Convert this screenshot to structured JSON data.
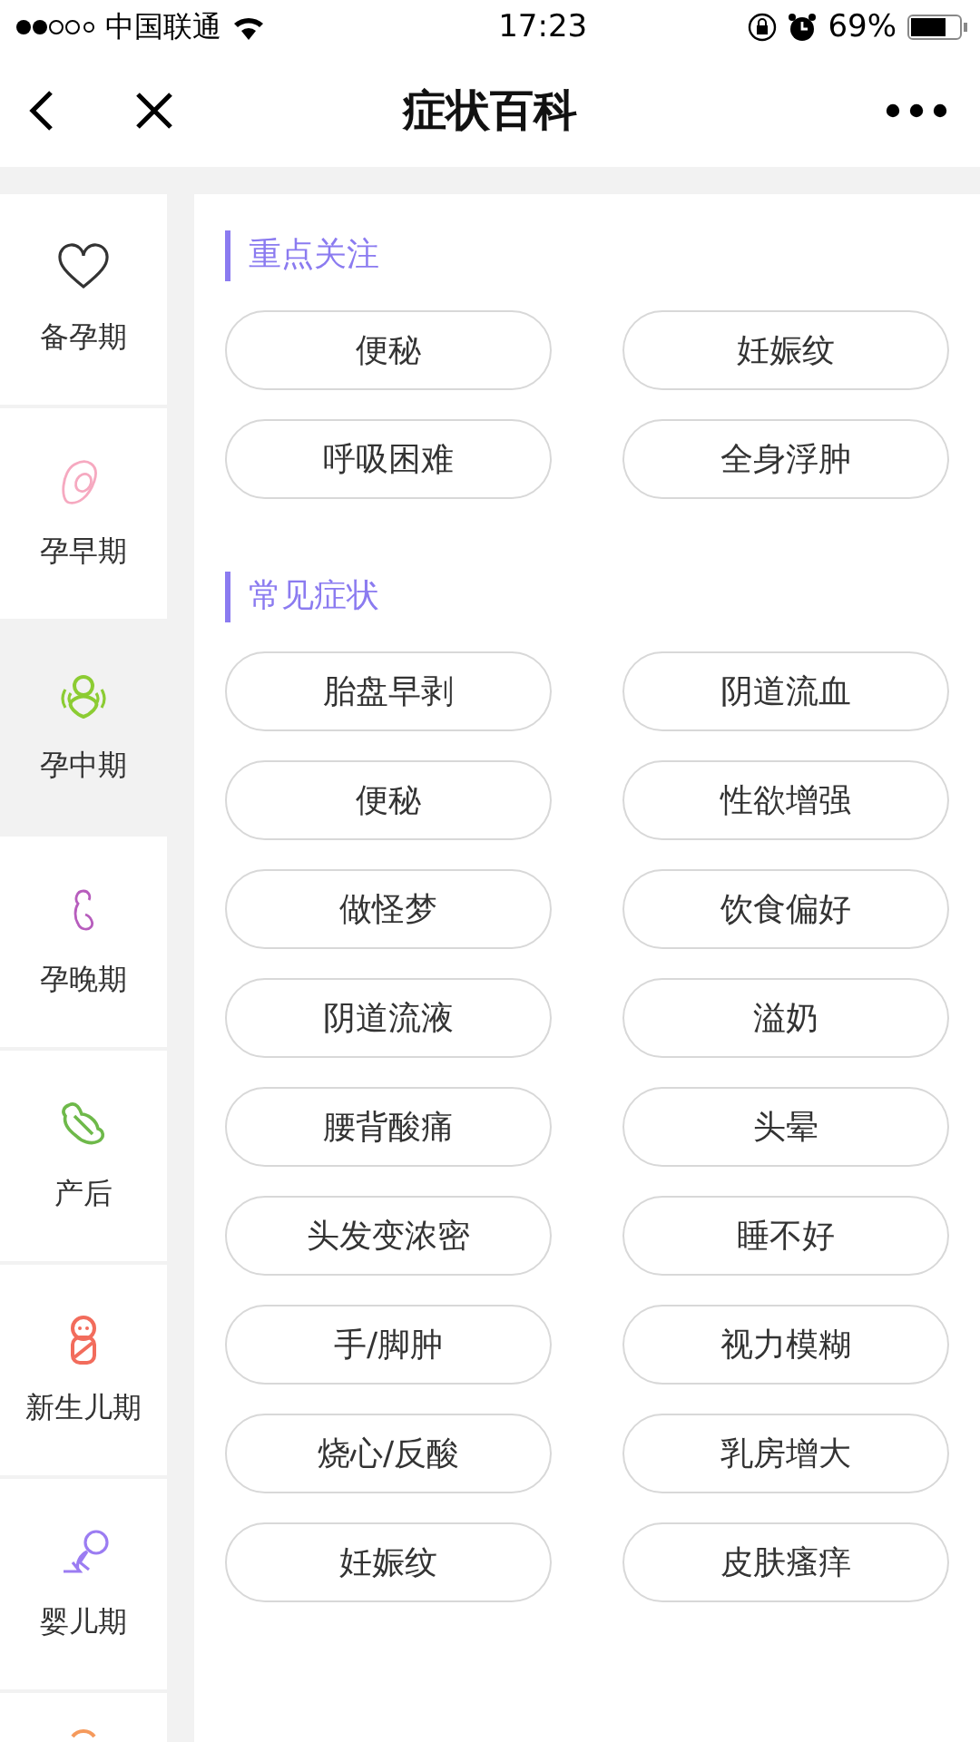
{
  "status_bar": {
    "carrier": "中国联通",
    "time": "17:23",
    "battery": "69%"
  },
  "nav": {
    "title": "症状百科"
  },
  "sidebar": {
    "items": [
      {
        "label": "备孕期",
        "selected": false
      },
      {
        "label": "孕早期",
        "selected": false
      },
      {
        "label": "孕中期",
        "selected": true
      },
      {
        "label": "孕晚期",
        "selected": false
      },
      {
        "label": "产后",
        "selected": false
      },
      {
        "label": "新生儿期",
        "selected": false
      },
      {
        "label": "婴儿期",
        "selected": false
      },
      {
        "selected": false
      }
    ]
  },
  "sections": [
    {
      "title": "重点关注",
      "tags": [
        "便秘",
        "妊娠纹",
        "呼吸困难",
        "全身浮肿"
      ]
    },
    {
      "title": "常见症状",
      "tags": [
        "胎盘早剥",
        "阴道流血",
        "便秘",
        "性欲增强",
        "做怪梦",
        "饮食偏好",
        "阴道流液",
        "溢奶",
        "腰背酸痛",
        "头晕",
        "头发变浓密",
        "睡不好",
        "手/脚肿",
        "视力模糊",
        "烧心/反酸",
        "乳房增大",
        "妊娠纹",
        "皮肤瘙痒"
      ]
    }
  ]
}
